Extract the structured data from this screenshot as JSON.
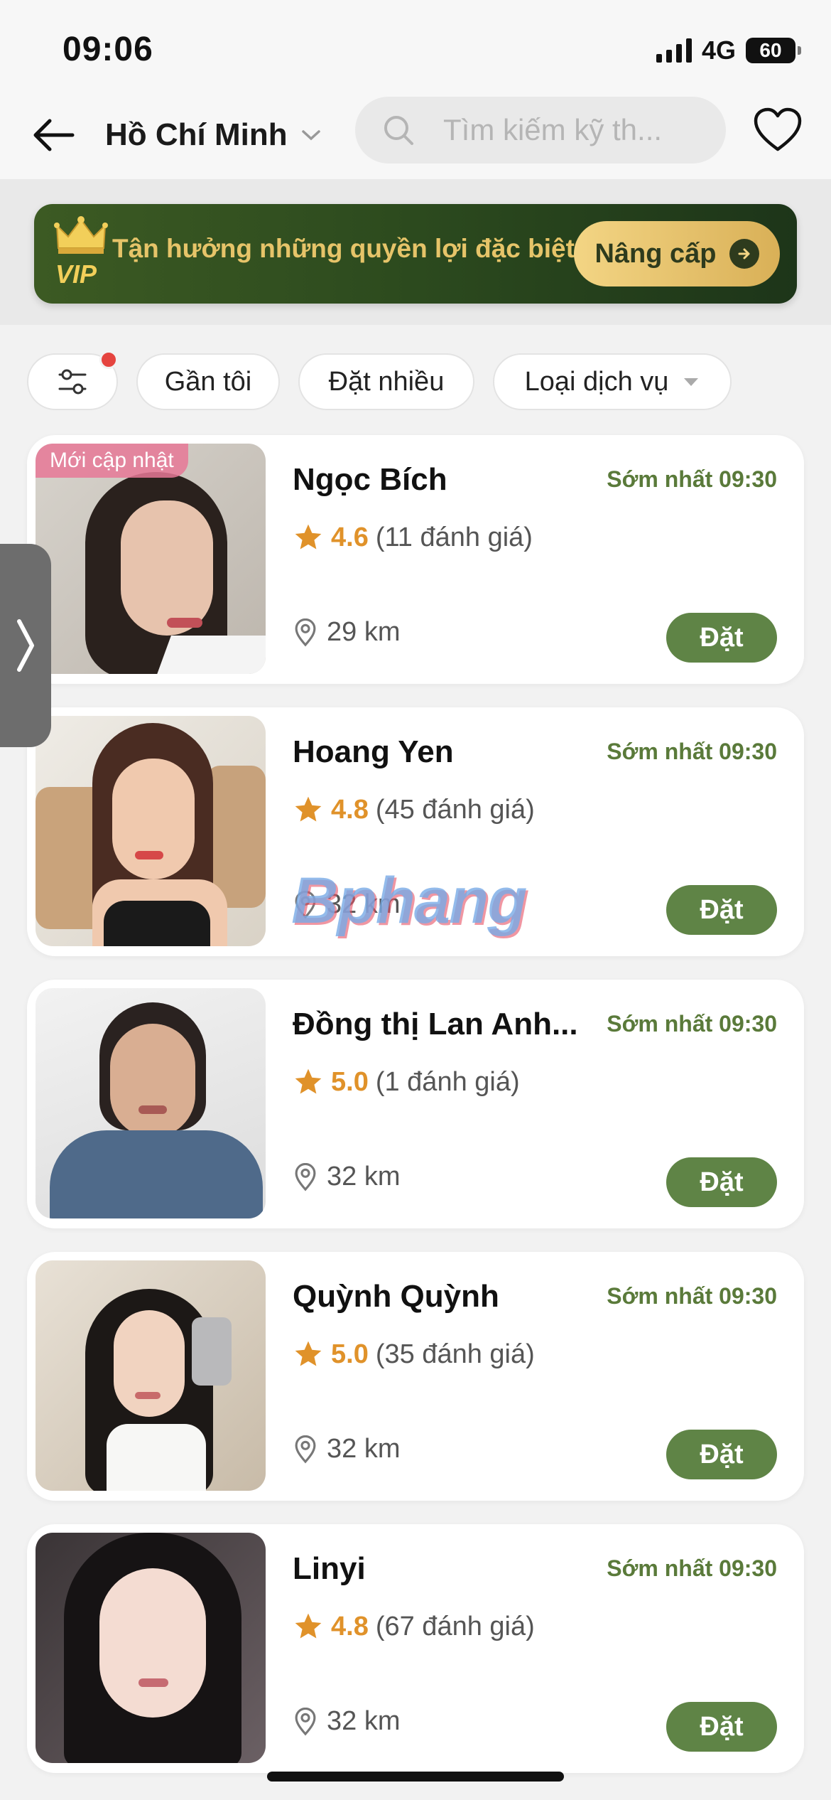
{
  "status_bar": {
    "time": "09:06",
    "network": "4G",
    "battery": "60"
  },
  "header": {
    "city": "Hồ Chí Minh",
    "search_placeholder": "Tìm kiếm kỹ th..."
  },
  "vip_banner": {
    "badge": "VIP",
    "text": "Tận hưởng những quyền lợi đặc biệt",
    "button": "Nâng cấp"
  },
  "filters": {
    "near_me": "Gần tôi",
    "most_booked": "Đặt nhiều",
    "service_type": "Loại dịch vụ"
  },
  "cards": [
    {
      "badge": "Mới cập nhật",
      "name": "Ngọc Bích",
      "earliest": "Sớm nhất 09:30",
      "rating": "4.6",
      "reviews": "(11 đánh giá)",
      "distance": "29 km",
      "book": "Đặt"
    },
    {
      "name": "Hoang Yen",
      "earliest": "Sớm nhất 09:30",
      "rating": "4.8",
      "reviews": "(45 đánh giá)",
      "distance": "32 km",
      "book": "Đặt"
    },
    {
      "name": "Đồng thị Lan Anh...",
      "earliest": "Sớm nhất 09:30",
      "rating": "5.0",
      "reviews": "(1 đánh giá)",
      "distance": "32 km",
      "book": "Đặt"
    },
    {
      "name": "Quỳnh Quỳnh",
      "earliest": "Sớm nhất 09:30",
      "rating": "5.0",
      "reviews": "(35 đánh giá)",
      "distance": "32 km",
      "book": "Đặt"
    },
    {
      "name": "Linyi",
      "earliest": "Sớm nhất 09:30",
      "rating": "4.8",
      "reviews": "(67 đánh giá)",
      "distance": "32 km",
      "book": "Đặt"
    }
  ],
  "watermark": "Bphang",
  "colors": {
    "accent_green": "#5f8446",
    "rating_orange": "#e0922a",
    "vip_gold": "#e6c469",
    "notify_red": "#e5443f"
  }
}
